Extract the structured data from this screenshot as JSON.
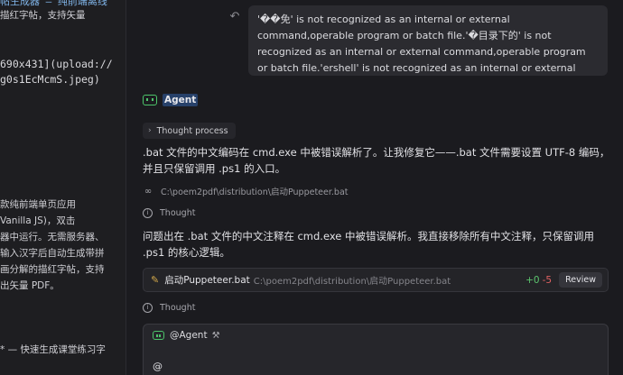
{
  "editor": {
    "lines": [
      {
        "text": "帖生成器 — 纯前端离线",
        "style": "head"
      },
      {
        "text": "描红字帖，支持矢量",
        "style": "cjk"
      },
      {
        "text": "690x431](upload://",
        "style": "link"
      },
      {
        "text": "g0s1EcMcmS.jpeg)",
        "style": "link"
      },
      {
        "text": "款纯前端单页应用",
        "style": "cjk"
      },
      {
        "text": " Vanilla JS)，双击",
        "style": "cjk"
      },
      {
        "text": "器中运行。无需服务器、",
        "style": "cjk"
      },
      {
        "text": "输入汉字后自动生成带拼",
        "style": "cjk"
      },
      {
        "text": "画分解的描红字帖，支持",
        "style": "cjk"
      },
      {
        "text": "出矢量 PDF。",
        "style": "cjk"
      },
      {
        "text": "* — 快速生成课堂练习字",
        "style": "cjk"
      }
    ]
  },
  "chat": {
    "user_message": "'��免' is not recognized as an internal or external command,operable program or batch file.'�目录下的' is not recognized as an internal or external command,operable program or batch file.'ershell' is not recognized as an internal or external command,operable program or batch file.Press any key to continue . . .",
    "agent_name": "Agent",
    "thought_process_label": "Thought process",
    "para1": ".bat 文件的中文编码在 cmd.exe 中被错误解析了。让我修复它——.bat 文件需要设置 UTF-8 编码，并且只保留调用 .ps1 的入口。",
    "read_path": "C:\\poem2pdf\\distribution\\启动Puppeteer.bat",
    "thought_label_1": "Thought",
    "para2": "问题出在 .bat 文件的中文注释在 cmd.exe 中被错误解析。我直接移除所有中文注释，只保留调用 .ps1 的核心逻辑。",
    "file_card": {
      "file_name": "启动Puppeteer.bat",
      "file_path": "C:\\poem2pdf\\distribution\\启动Puppeteer.bat",
      "additions": "+0",
      "deletions": "-5",
      "review_label": "Review"
    },
    "thought_label_2": "Thought",
    "composer": {
      "mention": "@Agent",
      "input_value": "@"
    }
  },
  "colors": {
    "background": "#1b1b1f",
    "accent_green": "#4cc46a",
    "diff_add": "#5cc46e",
    "diff_del": "#e06262",
    "agent_highlight": "#27416a"
  },
  "icons": [
    "undo-icon",
    "bot-icon",
    "chevron-right-icon",
    "glasses-icon",
    "info-icon",
    "pencil-icon",
    "tools-icon"
  ]
}
